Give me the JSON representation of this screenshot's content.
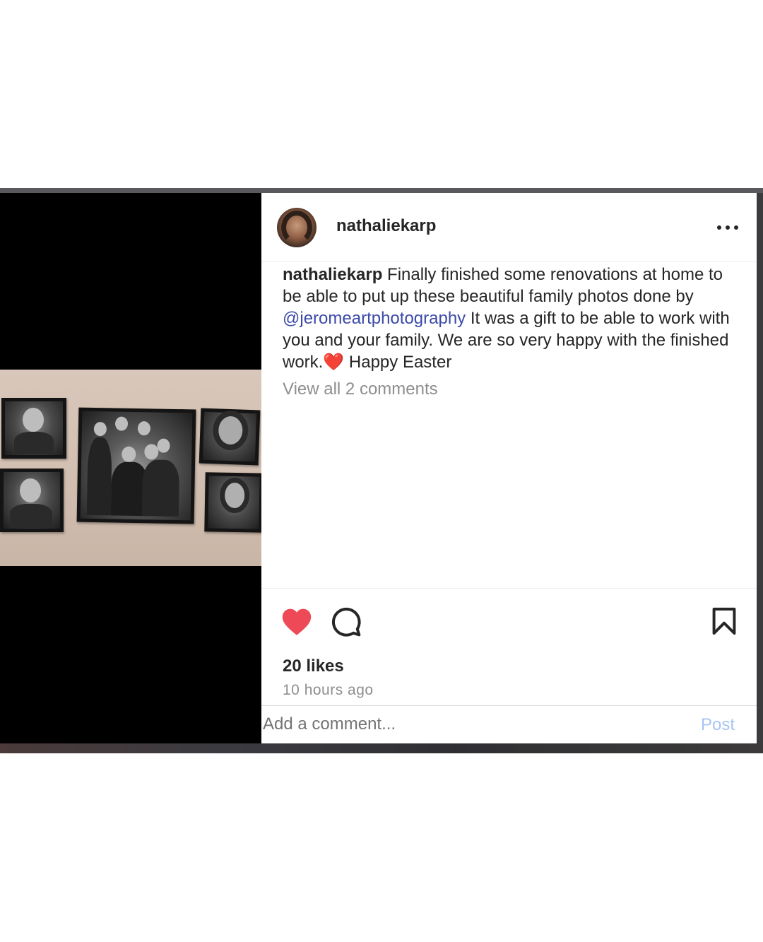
{
  "post": {
    "username": "nathaliekarp",
    "more_icon": "more-horizontal-icon",
    "caption": {
      "username": "nathaliekarp",
      "text_before": " Finally finished some renovations at home to be able to put up these beautiful family photos done by ",
      "mention": "@jeromeartphotography",
      "text_after": " It was a gift to be able to work with you and your family. We are so very happy with the finished work.",
      "emoji": "❤️",
      "text_end": " Happy Easter"
    },
    "view_comments": "View all 2 comments",
    "likes": "20 likes",
    "time_ago": "10 hours ago",
    "comment": {
      "placeholder": "Add a comment...",
      "post_label": "Post"
    }
  },
  "icons": {
    "like": "heart-filled-icon",
    "comment": "comment-bubble-icon",
    "save": "bookmark-icon"
  },
  "colors": {
    "like_red": "#ed4956",
    "mention_blue": "#3b4aa8",
    "post_button": "#a7c4f4",
    "muted_text": "#8e8e8e"
  }
}
